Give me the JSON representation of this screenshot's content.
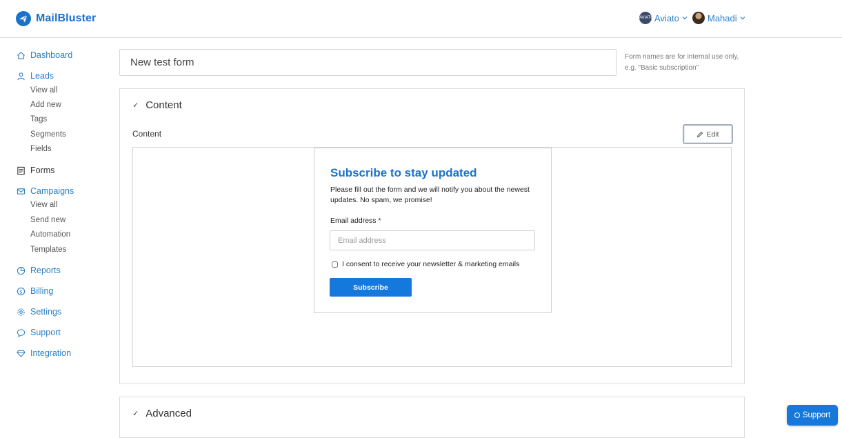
{
  "brand": {
    "name": "MailBluster",
    "color": "#1a73c9"
  },
  "header": {
    "accounts": [
      {
        "name": "Aviato",
        "avatar_text": "AVIATO"
      },
      {
        "name": "Mahadi"
      }
    ]
  },
  "sidebar": {
    "items": [
      {
        "label": "Dashboard",
        "icon": "home-icon"
      },
      {
        "label": "Leads",
        "icon": "user-icon",
        "sub": [
          "View all",
          "Add new",
          "Tags",
          "Segments",
          "Fields"
        ]
      },
      {
        "label": "Forms",
        "icon": "form-icon"
      },
      {
        "label": "Campaigns",
        "icon": "envelope-icon",
        "sub": [
          "View all",
          "Send new",
          "Automation",
          "Templates"
        ]
      },
      {
        "label": "Reports",
        "icon": "pie-chart-icon"
      },
      {
        "label": "Billing",
        "icon": "dollar-icon"
      },
      {
        "label": "Settings",
        "icon": "gear-icon"
      },
      {
        "label": "Support",
        "icon": "chat-icon"
      },
      {
        "label": "Integration",
        "icon": "diamond-icon"
      }
    ]
  },
  "form_name": {
    "value": "New test form",
    "hint_line1": "Form names are for internal use only,",
    "hint_line2": "e.g. \"Basic subscription\""
  },
  "content_panel": {
    "heading": "Content",
    "section_label": "Content",
    "edit_label": "Edit"
  },
  "preview_form": {
    "title": "Subscribe to stay updated",
    "description": "Please fill out the form and we will notify you about the newest updates. No spam, we promise!",
    "email_label": "Email address *",
    "email_placeholder": "Email address",
    "consent_label": "I consent to receive your newsletter & marketing emails",
    "submit_label": "Subscribe",
    "button_color": "#1578dd"
  },
  "advanced_panel": {
    "heading": "Advanced"
  },
  "support_float": {
    "label": "Support"
  }
}
